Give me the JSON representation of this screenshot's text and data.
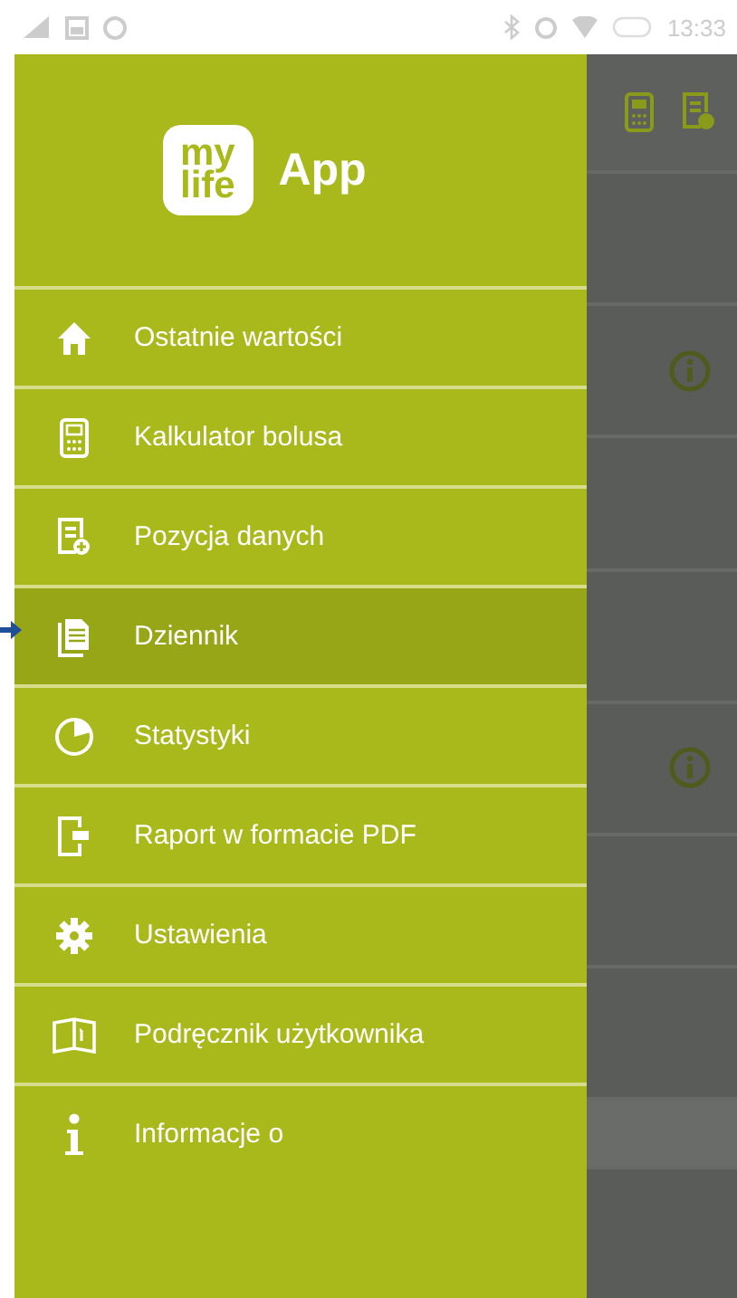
{
  "status_bar": {
    "time": "13:33"
  },
  "drawer": {
    "logo": {
      "line_1": "my",
      "line_2": "life"
    },
    "title": "App",
    "items": [
      {
        "kind": "home",
        "label": "Ostatnie wartości",
        "selected": false
      },
      {
        "kind": "calculator",
        "label": "Kalkulator bolusa",
        "selected": false
      },
      {
        "kind": "entry",
        "label": "Pozycja danych",
        "selected": false
      },
      {
        "kind": "logbook",
        "label": "Dziennik",
        "selected": true
      },
      {
        "kind": "stats",
        "label": "Statystyki",
        "selected": false
      },
      {
        "kind": "export",
        "label": "Raport w formacie PDF",
        "selected": false
      },
      {
        "kind": "settings",
        "label": "Ustawienia",
        "selected": false
      },
      {
        "kind": "manual",
        "label": "Podręcznik użytkownika",
        "selected": false
      },
      {
        "kind": "info",
        "label": "Informacje o",
        "selected": false
      }
    ]
  },
  "background_rows": [
    {
      "info": false
    },
    {
      "info": true
    },
    {
      "info": false
    },
    {
      "info": false
    },
    {
      "info": true
    },
    {
      "info": false
    },
    {
      "info": false
    },
    {
      "kind": "header",
      "info": false
    },
    {
      "info": false
    }
  ]
}
